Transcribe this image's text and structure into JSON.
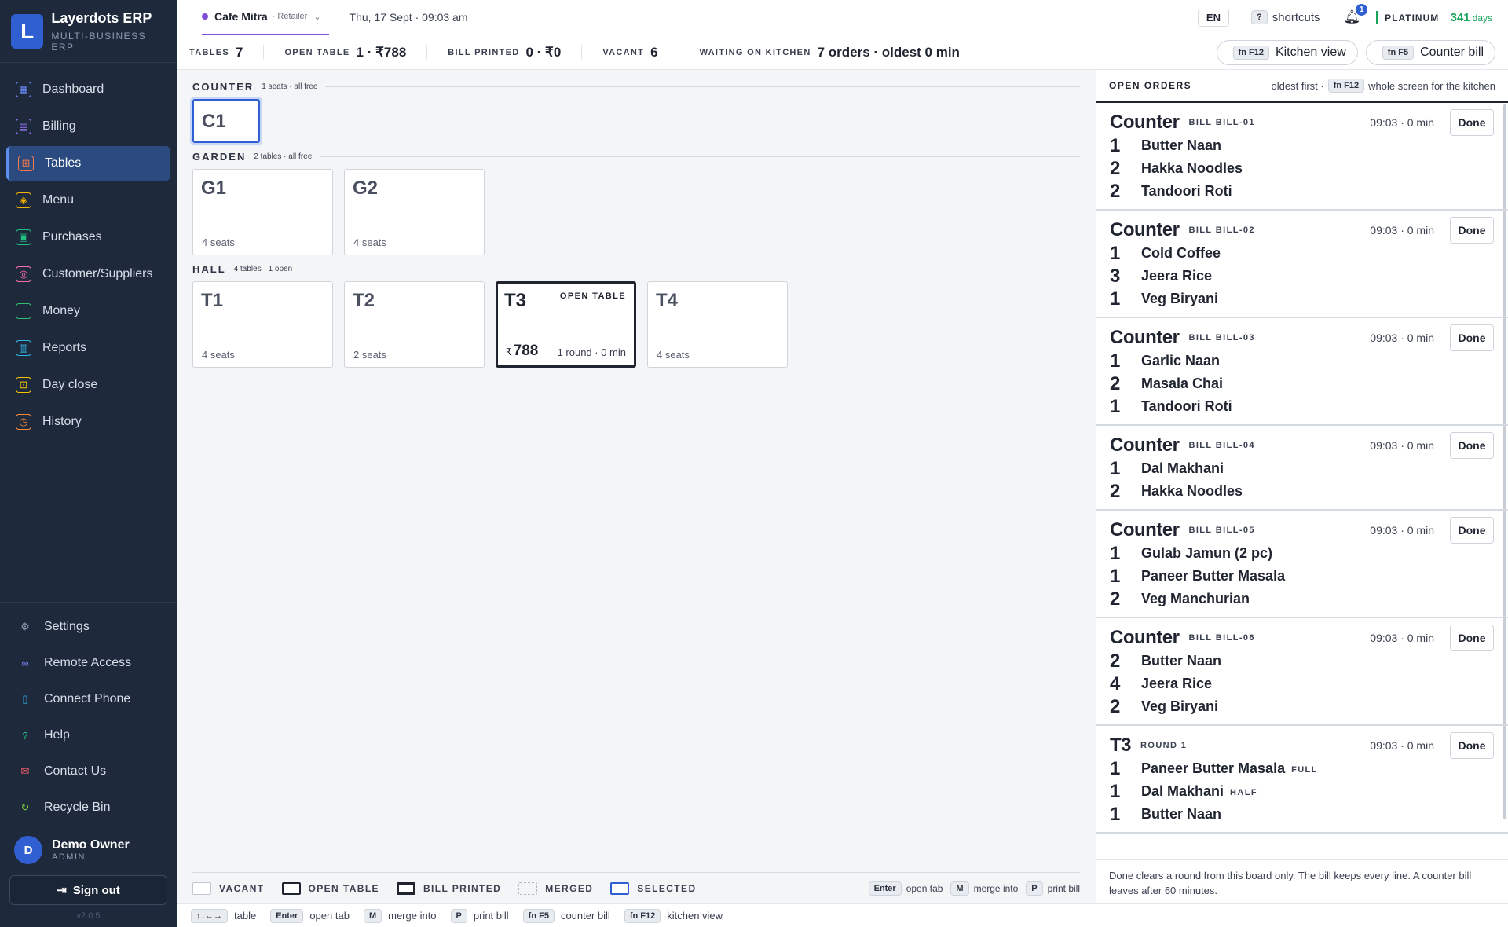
{
  "brand": {
    "name": "Layerdots ERP",
    "subtitle": "MULTI-BUSINESS ERP",
    "logo_letter": "L"
  },
  "sidebar": {
    "items": [
      {
        "label": "Dashboard",
        "icon": "grid-icon",
        "color": "#6b8cff",
        "active": false
      },
      {
        "label": "Billing",
        "icon": "document-icon",
        "color": "#9b7bff",
        "active": false
      },
      {
        "label": "Tables",
        "icon": "table-icon",
        "color": "#ff7a45",
        "active": true
      },
      {
        "label": "Menu",
        "icon": "box-icon",
        "color": "#f5b400",
        "active": false
      },
      {
        "label": "Purchases",
        "icon": "cart-icon",
        "color": "#20c080",
        "active": false
      },
      {
        "label": "Customer/Suppliers",
        "icon": "users-icon",
        "color": "#ff6fa8",
        "active": false
      },
      {
        "label": "Money",
        "icon": "cash-icon",
        "color": "#30c070",
        "active": false
      },
      {
        "label": "Reports",
        "icon": "chart-icon",
        "color": "#35b4e8",
        "active": false
      },
      {
        "label": "Day close",
        "icon": "lock-icon",
        "color": "#f5c400",
        "active": false
      },
      {
        "label": "History",
        "icon": "clock-icon",
        "color": "#ff8c3a",
        "active": false
      }
    ],
    "bottom": [
      {
        "label": "Settings",
        "icon": "gear-icon",
        "color": "#8f9bb0"
      },
      {
        "label": "Remote Access",
        "icon": "link-icon",
        "color": "#7b8cff"
      },
      {
        "label": "Connect Phone",
        "icon": "phone-icon",
        "color": "#35b4e8"
      },
      {
        "label": "Help",
        "icon": "help-icon",
        "color": "#20c080"
      },
      {
        "label": "Contact Us",
        "icon": "mail-icon",
        "color": "#ff5f6f"
      },
      {
        "label": "Recycle Bin",
        "icon": "recycle-icon",
        "color": "#7bd040"
      }
    ]
  },
  "user": {
    "initial": "D",
    "name": "Demo Owner",
    "role": "ADMIN",
    "signout": "Sign out",
    "version": "v2.0.5"
  },
  "topbar": {
    "business": "Cafe Mitra",
    "business_type": "· Retailer",
    "date": "Thu, 17 Sept · 09:03 am",
    "lang": "EN",
    "shortcuts_key": "?",
    "shortcuts_label": "shortcuts",
    "notif_count": "1",
    "plan": "PLATINUM",
    "plan_days": "341",
    "plan_unit": "days"
  },
  "stats": {
    "tables_label": "TABLES",
    "tables_val": "7",
    "open_label": "OPEN TABLE",
    "open_val": "1 · ₹788",
    "bill_label": "BILL PRINTED",
    "bill_val": "0 · ₹0",
    "vacant_label": "VACANT",
    "vacant_val": "6",
    "kitchen_label": "WAITING ON KITCHEN",
    "kitchen_val": "7 orders · oldest 0 min",
    "kitchen_btn_key": "fn F12",
    "kitchen_btn": "Kitchen view",
    "counter_btn_key": "fn F5",
    "counter_btn": "Counter bill"
  },
  "sections": {
    "counter": {
      "title": "COUNTER",
      "meta": "1 seats · all free",
      "tiles": [
        {
          "name": "C1"
        }
      ]
    },
    "garden": {
      "title": "GARDEN",
      "meta": "2 tables · all free",
      "tiles": [
        {
          "name": "G1",
          "seats": "4 seats"
        },
        {
          "name": "G2",
          "seats": "4 seats"
        }
      ]
    },
    "hall": {
      "title": "HALL",
      "meta": "4 tables · 1 open",
      "tiles": [
        {
          "name": "T1",
          "seats": "4 seats"
        },
        {
          "name": "T2",
          "seats": "2 seats"
        },
        {
          "name": "T3",
          "tag": "OPEN TABLE",
          "currency": "₹",
          "amount": "788",
          "round": "1 round · 0 min"
        },
        {
          "name": "T4",
          "seats": "4 seats"
        }
      ]
    }
  },
  "legend": {
    "vacant": "VACANT",
    "open": "OPEN TABLE",
    "bill": "BILL PRINTED",
    "merged": "MERGED",
    "selected": "SELECTED",
    "keys": [
      {
        "key": "Enter",
        "label": "open tab"
      },
      {
        "key": "M",
        "label": "merge into"
      },
      {
        "key": "P",
        "label": "print bill"
      }
    ]
  },
  "orders": {
    "title": "OPEN ORDERS",
    "meta_prefix": "oldest first ·",
    "meta_key": "fn F12",
    "meta_suffix": "whole screen for the kitchen",
    "done_label": "Done",
    "list": [
      {
        "name": "Counter",
        "bill": "BILL BILL-01",
        "time": "09:03 · 0 min",
        "lines": [
          {
            "qty": "1",
            "item": "Butter Naan"
          },
          {
            "qty": "2",
            "item": "Hakka Noodles"
          },
          {
            "qty": "2",
            "item": "Tandoori Roti"
          }
        ]
      },
      {
        "name": "Counter",
        "bill": "BILL BILL-02",
        "time": "09:03 · 0 min",
        "lines": [
          {
            "qty": "1",
            "item": "Cold Coffee"
          },
          {
            "qty": "3",
            "item": "Jeera Rice"
          },
          {
            "qty": "1",
            "item": "Veg Biryani"
          }
        ]
      },
      {
        "name": "Counter",
        "bill": "BILL BILL-03",
        "time": "09:03 · 0 min",
        "lines": [
          {
            "qty": "1",
            "item": "Garlic Naan"
          },
          {
            "qty": "2",
            "item": "Masala Chai"
          },
          {
            "qty": "1",
            "item": "Tandoori Roti"
          }
        ]
      },
      {
        "name": "Counter",
        "bill": "BILL BILL-04",
        "time": "09:03 · 0 min",
        "lines": [
          {
            "qty": "1",
            "item": "Dal Makhani"
          },
          {
            "qty": "2",
            "item": "Hakka Noodles"
          }
        ]
      },
      {
        "name": "Counter",
        "bill": "BILL BILL-05",
        "time": "09:03 · 0 min",
        "lines": [
          {
            "qty": "1",
            "item": "Gulab Jamun (2 pc)"
          },
          {
            "qty": "1",
            "item": "Paneer Butter Masala"
          },
          {
            "qty": "2",
            "item": "Veg Manchurian"
          }
        ]
      },
      {
        "name": "Counter",
        "bill": "BILL BILL-06",
        "time": "09:03 · 0 min",
        "lines": [
          {
            "qty": "2",
            "item": "Butter Naan"
          },
          {
            "qty": "4",
            "item": "Jeera Rice"
          },
          {
            "qty": "2",
            "item": "Veg Biryani"
          }
        ]
      },
      {
        "name": "T3",
        "bill": "ROUND 1",
        "time": "09:03 · 0 min",
        "lines": [
          {
            "qty": "1",
            "item": "Paneer Butter Masala",
            "mod": "FULL"
          },
          {
            "qty": "1",
            "item": "Dal Makhani",
            "mod": "HALF"
          },
          {
            "qty": "1",
            "item": "Butter Naan"
          }
        ]
      }
    ],
    "footer": "Done clears a round from this board only. The bill keeps every line. A counter bill leaves after 60 minutes."
  },
  "bottombar": [
    {
      "key": "↑↓←→",
      "label": "table"
    },
    {
      "key": "Enter",
      "label": "open tab"
    },
    {
      "key": "M",
      "label": "merge into"
    },
    {
      "key": "P",
      "label": "print bill"
    },
    {
      "key": "fn F5",
      "label": "counter bill"
    },
    {
      "key": "fn F12",
      "label": "kitchen view"
    }
  ]
}
